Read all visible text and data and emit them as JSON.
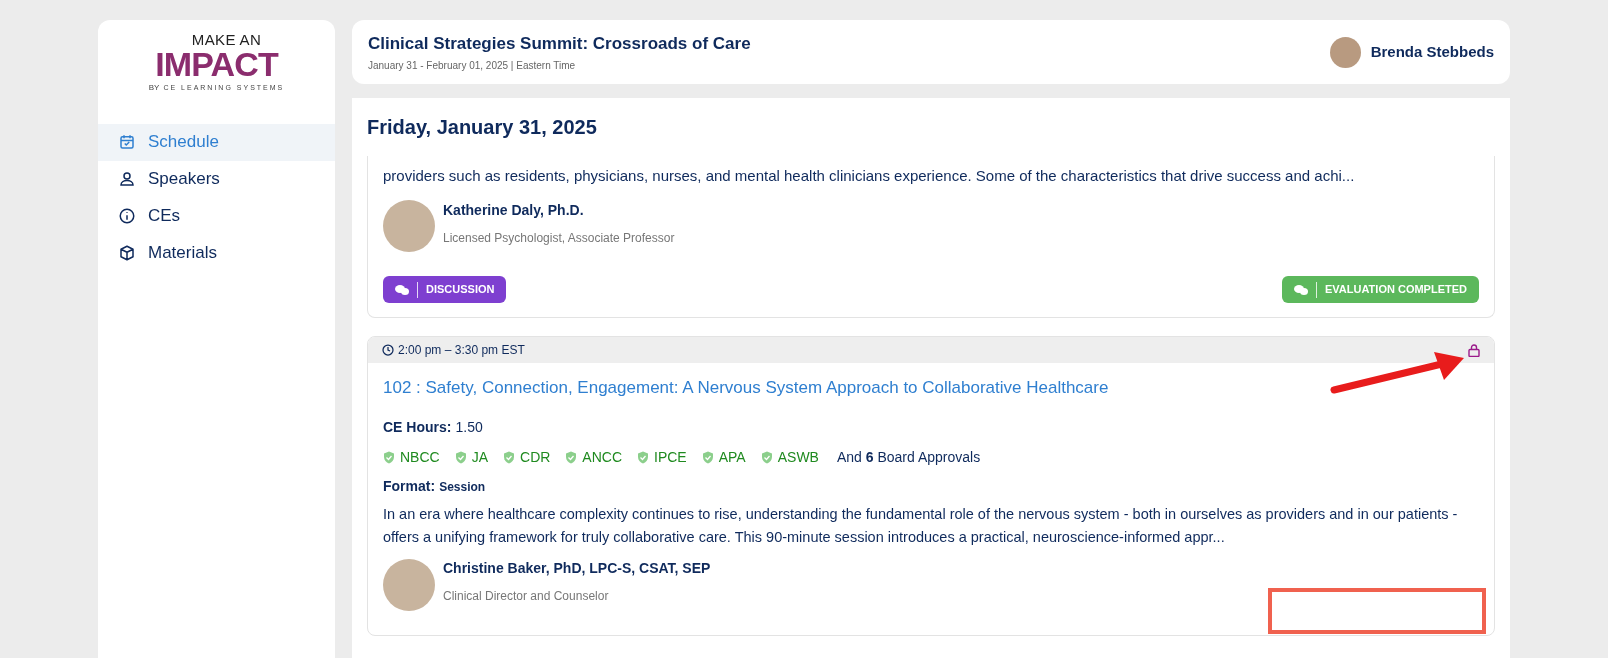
{
  "logo": {
    "top": "MAKE AN",
    "main": "IMPACT",
    "by": "BY",
    "company": "CE LEARNING SYSTEMS"
  },
  "sidebar": {
    "items": [
      {
        "label": "Schedule",
        "selected": true
      },
      {
        "label": "Speakers",
        "selected": false
      },
      {
        "label": "CEs",
        "selected": false
      },
      {
        "label": "Materials",
        "selected": false
      }
    ]
  },
  "header": {
    "title": "Clinical Strategies Summit: Crossroads of Care",
    "subtitle": "January 31 - February 01, 2025 | Eastern Time",
    "user": "Brenda Stebbeds"
  },
  "day_heading": "Friday, January 31, 2025",
  "sessions": [
    {
      "description": "providers such as residents, physicians, nurses, and mental health clinicians experience. Some of the characteristics that drive success and achi...",
      "speaker": {
        "name": "Katherine Daly, Ph.D.",
        "role": "Licensed Psychologist, Associate Professor"
      },
      "buttons": [
        {
          "label": "DISCUSSION",
          "color": "#7e3fd0"
        },
        {
          "label": "EVALUATION COMPLETED",
          "color": "#5cb85c"
        }
      ]
    },
    {
      "time": "2:00 pm – 3:30 pm EST",
      "locked": true,
      "title": "102 : Safety, Connection, Engagement: A Nervous System Approach to Collaborative Healthcare",
      "ce_hours_label": "CE Hours:",
      "ce_hours": "1.50",
      "approvals": [
        "NBCC",
        "JA",
        "CDR",
        "ANCC",
        "IPCE",
        "APA",
        "ASWB"
      ],
      "more_approvals": "And **6** Board Approvals",
      "format_label": "Format:",
      "format": "Session",
      "description": "In an era where healthcare complexity continues to rise, understanding the fundamental role of the nervous system - both in ourselves as providers and in our patients - offers a unifying framework for truly collaborative care. This 90-minute session introduces a practical, neuroscience-informed appr...",
      "speaker": {
        "name": "Christine Baker, PhD, LPC-S, CSAT, SEP",
        "role": "Clinical Director and Counselor"
      }
    }
  ]
}
